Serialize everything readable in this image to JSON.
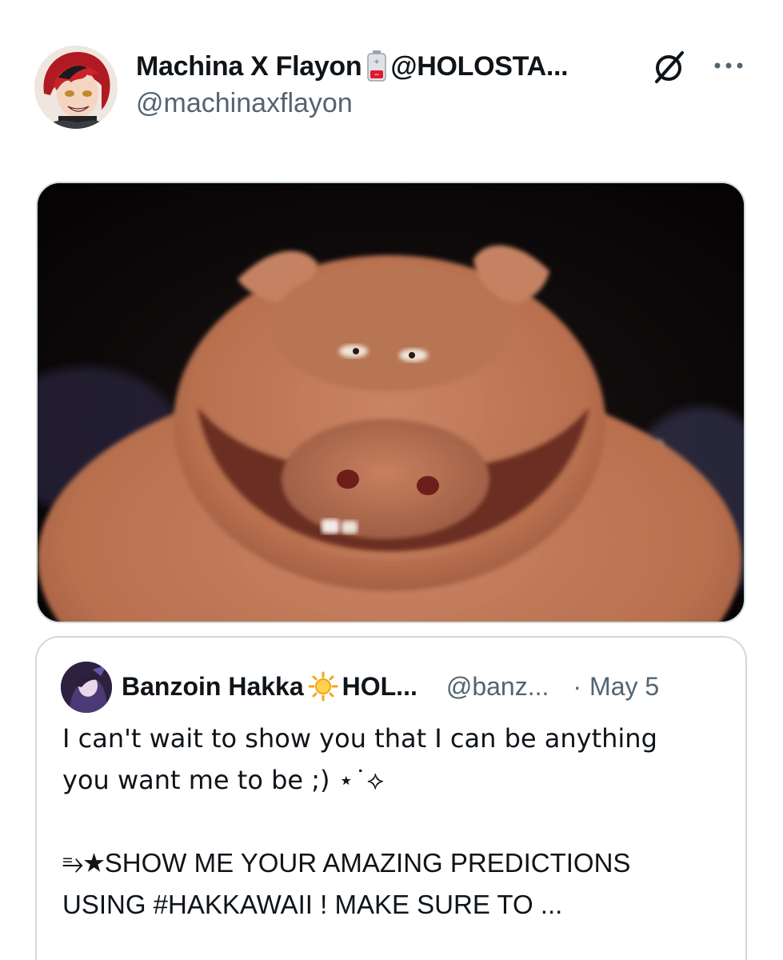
{
  "post": {
    "author": {
      "display_name": "Machina X Flayon",
      "name_suffix": "@HOLOSTA...",
      "handle": "@machinaxflayon",
      "avatar": "avatar",
      "badge_icon": "battery-icon"
    },
    "icons": {
      "grok": "grok-icon",
      "more": "more-icon"
    },
    "media": {
      "kind": "image"
    }
  },
  "quote": {
    "author": {
      "display_name": "Banzoin Hakka",
      "badge_icon": "sun-icon",
      "name_suffix": "HOL...",
      "handle": "@banz...",
      "separator": "·",
      "date": "May 5"
    },
    "body": {
      "line1": "I can't wait to show you that I can be anything",
      "line2": "you want me to be ;) ⋆˙⟡",
      "line3": "⥱★SHOW ME YOUR AMAZING PREDICTIONS",
      "line4": "USING #HAKKAWAII ! MAKE SURE TO ..."
    }
  },
  "colors": {
    "text_primary": "#0f1419",
    "text_secondary": "#536471",
    "border": "#cfd9de",
    "battery_red": "#e0192e",
    "sun_orange": "#f4a41a"
  }
}
